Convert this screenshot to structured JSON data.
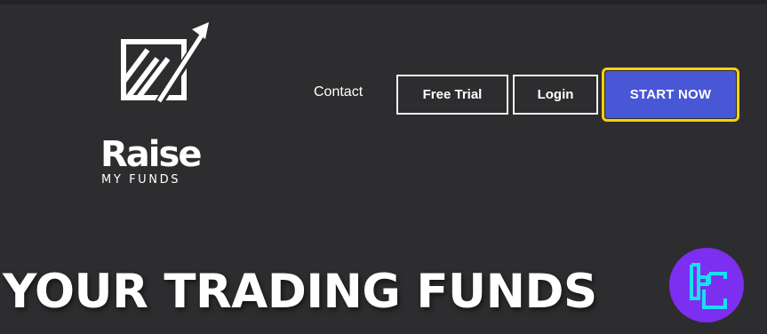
{
  "logo": {
    "wordmark": "Raise",
    "tagline": "MY FUNDS",
    "icon": "chart-arrow-up-icon"
  },
  "nav": {
    "contact": "Contact",
    "free_trial": "Free Trial",
    "login": "Login",
    "start_now": "START NOW"
  },
  "hero": {
    "title": "YOUR TRADING FUNDS"
  },
  "watermark": {
    "icon": "tc-monogram-icon"
  },
  "colors": {
    "background": "#2d2d2f",
    "accent_button": "#4857d6",
    "highlight_ring": "#f5d10d",
    "badge_fill": "#7c2ff0",
    "badge_glyph": "#18e0f0"
  }
}
